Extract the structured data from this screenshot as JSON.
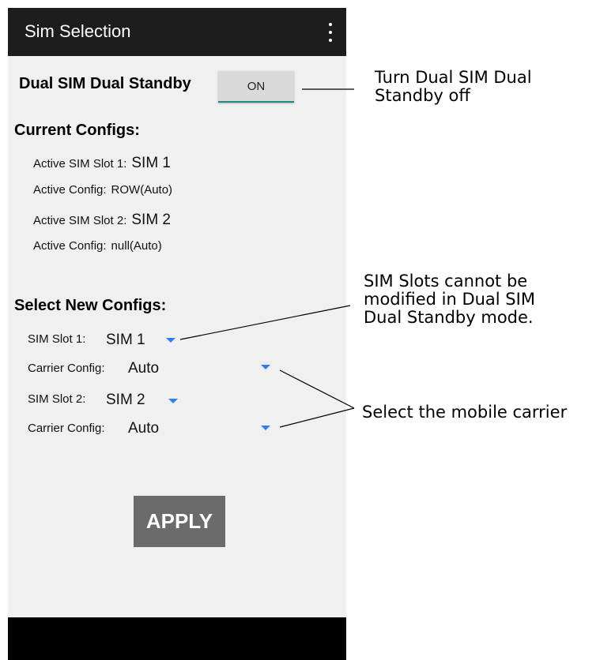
{
  "app": {
    "title": "Sim Selection",
    "overflow_icon": "more-vert-icon"
  },
  "dsds": {
    "label": "Dual SIM Dual Standby",
    "toggle": "ON"
  },
  "current": {
    "heading": "Current Configs:",
    "slot1_label": "Active SIM Slot 1:",
    "slot1_value": "SIM 1",
    "config1_label": "Active Config:",
    "config1_value": "ROW(Auto)",
    "slot2_label": "Active SIM Slot 2:",
    "slot2_value": "SIM 2",
    "config2_label": "Active Config:",
    "config2_value": "null(Auto)"
  },
  "select": {
    "heading": "Select New Configs:",
    "slot1_label": "SIM Slot 1:",
    "slot1_value": "SIM 1",
    "carrier1_label": "Carrier Config:",
    "carrier1_value": "Auto",
    "slot2_label": "SIM Slot 2:",
    "slot2_value": "SIM 2",
    "carrier2_label": "Carrier Config:",
    "carrier2_value": "Auto"
  },
  "apply_label": "APPLY",
  "callouts": {
    "dsds_line1": "Turn Dual SIM Dual",
    "dsds_line2": "Standby off",
    "slots_line1": "SIM Slots cannot be",
    "slots_line2": "modified in Dual SIM",
    "slots_line3": "Dual Standby mode.",
    "carrier": "Select the mobile carrier"
  },
  "colors": {
    "app_bar": "#1d1d1d",
    "screen_bg": "#f0f0f0",
    "toggle_underline": "#1f8b83",
    "dropdown_caret": "#2a7fff",
    "apply_button": "#6b6b6b"
  }
}
